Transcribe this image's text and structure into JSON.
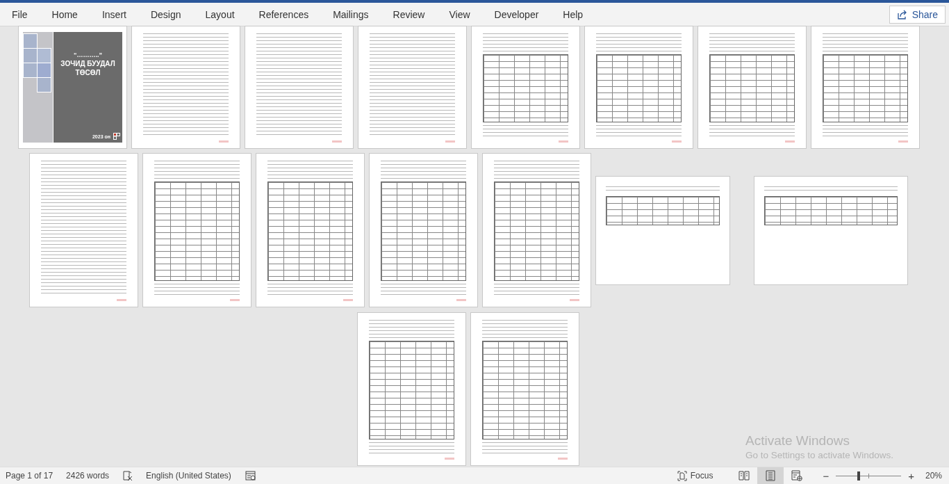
{
  "menu": {
    "tabs": [
      {
        "label": "File"
      },
      {
        "label": "Home"
      },
      {
        "label": "Insert"
      },
      {
        "label": "Design"
      },
      {
        "label": "Layout"
      },
      {
        "label": "References"
      },
      {
        "label": "Mailings"
      },
      {
        "label": "Review"
      },
      {
        "label": "View"
      },
      {
        "label": "Developer"
      },
      {
        "label": "Help"
      }
    ]
  },
  "share_button": {
    "label": "Share"
  },
  "rows": [
    {
      "pages": [
        {
          "kind": "cover",
          "quote": "“………..”",
          "title": "ЗОЧИД БУУДАЛ ТӨСӨЛ",
          "year": "2023 он"
        },
        {
          "kind": "text"
        },
        {
          "kind": "text"
        },
        {
          "kind": "text"
        },
        {
          "kind": "table"
        },
        {
          "kind": "table"
        },
        {
          "kind": "table"
        },
        {
          "kind": "table"
        }
      ]
    },
    {
      "pages": [
        {
          "kind": "text"
        },
        {
          "kind": "table"
        },
        {
          "kind": "table"
        },
        {
          "kind": "table"
        },
        {
          "kind": "table"
        },
        {
          "kind": "landscape"
        },
        {
          "kind": "landscape"
        }
      ]
    },
    {
      "pages": [
        {
          "kind": "table"
        },
        {
          "kind": "table"
        }
      ]
    }
  ],
  "status_bar": {
    "page": "Page 1 of 17",
    "words": "2426 words",
    "language": "English (United States)",
    "focus": "Focus",
    "views": [
      {
        "kind": "read",
        "selected": false
      },
      {
        "kind": "print",
        "selected": true
      },
      {
        "kind": "web",
        "selected": false
      }
    ],
    "zoom": {
      "out": "−",
      "in": "+",
      "level": 0.35,
      "reading": "20%"
    }
  },
  "activation_notice": {
    "title": "Activate Windows",
    "message": "Go to Settings to activate Windows."
  }
}
